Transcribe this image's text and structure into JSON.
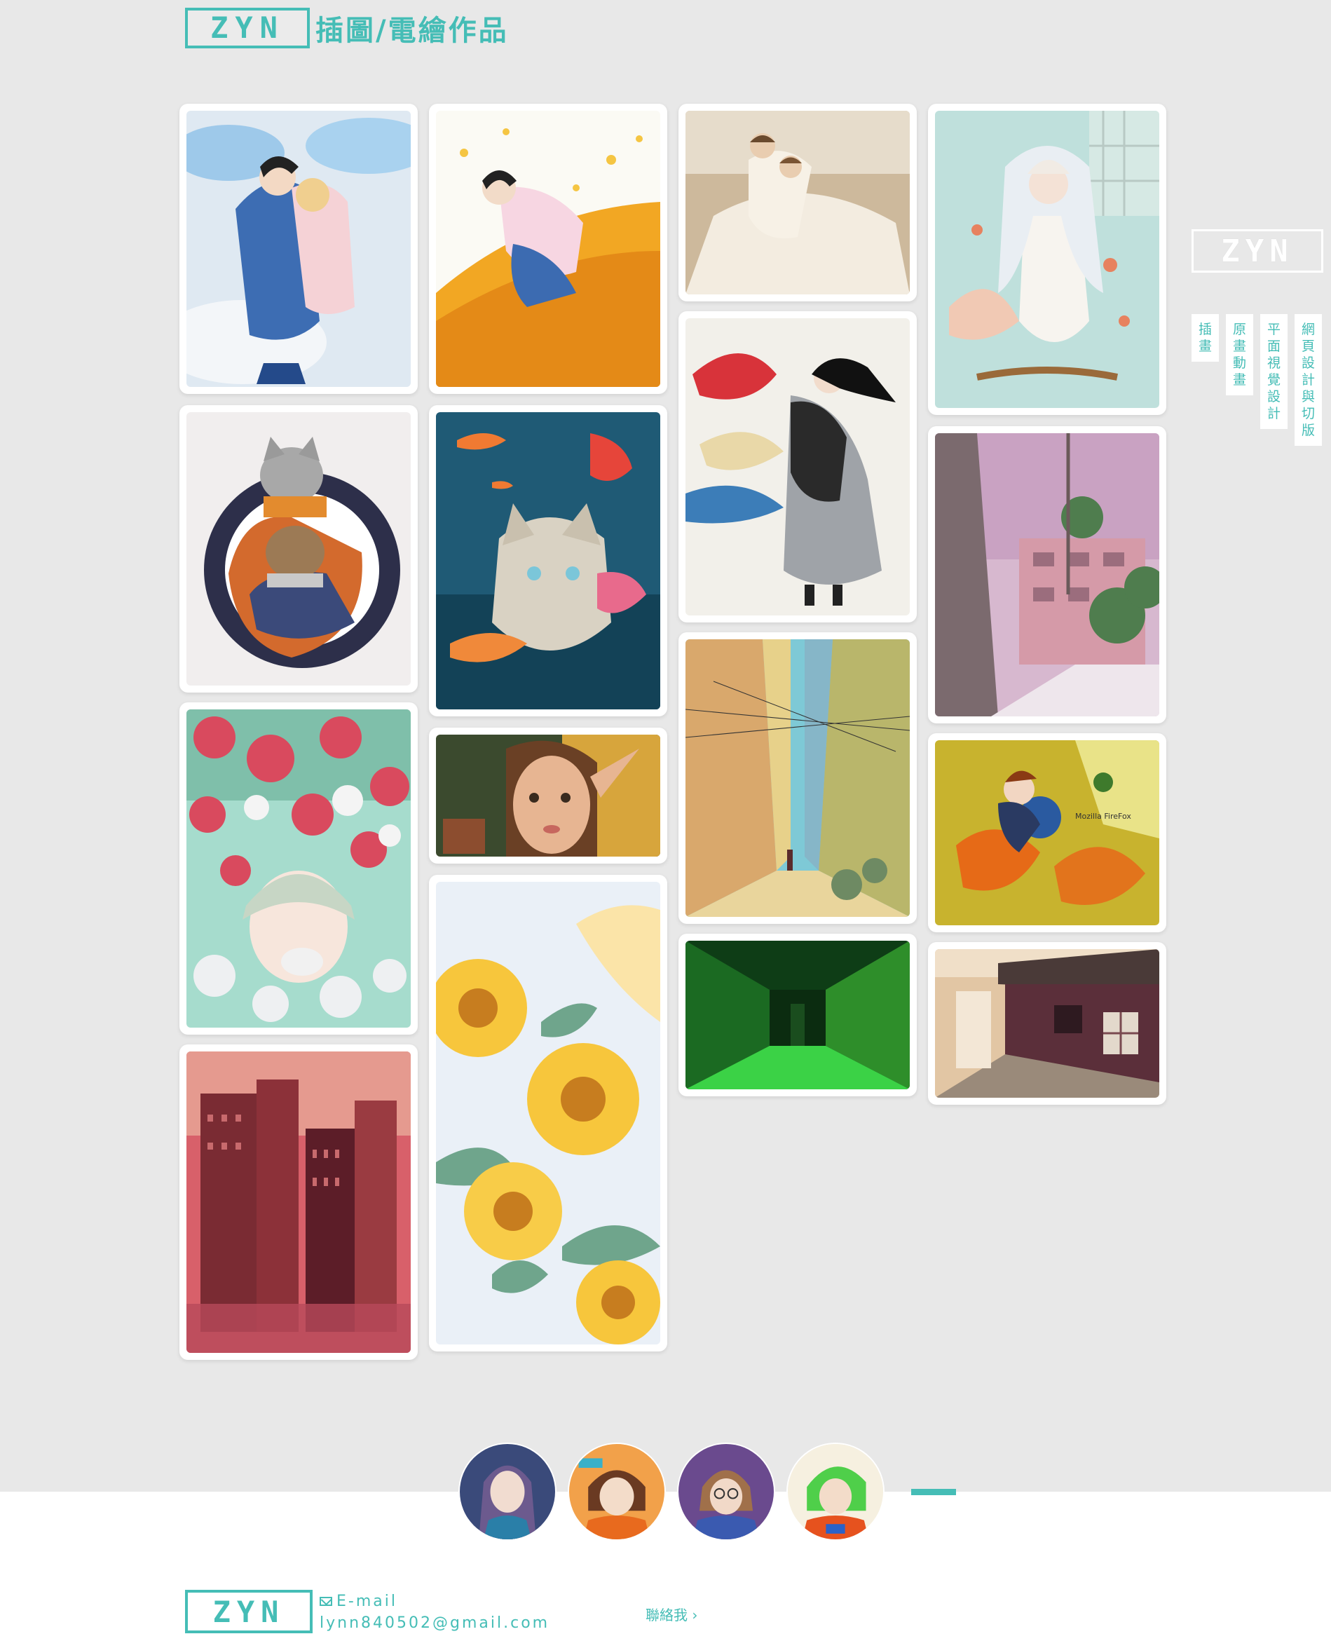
{
  "header": {
    "logo_text": "ZYN",
    "title": "插圖/電繪作品"
  },
  "side_nav": {
    "logo_text": "ZYN",
    "items": [
      {
        "label": [
          "插",
          "畫"
        ]
      },
      {
        "label": [
          "原",
          "畫",
          "動",
          "畫"
        ]
      },
      {
        "label": [
          "平",
          "面",
          "視",
          "覺",
          "設",
          "計"
        ]
      },
      {
        "label": [
          "網",
          "頁",
          "設",
          "計",
          "與",
          "切",
          "版"
        ]
      }
    ]
  },
  "gallery": {
    "artworks": [
      {
        "name": "artwork-girls-hug-clouds",
        "subject": "two girls hugging on clouds"
      },
      {
        "name": "artwork-cats-scarf",
        "subject": "two cats in scarf"
      },
      {
        "name": "artwork-lychee-girl",
        "subject": "girl with lychees"
      },
      {
        "name": "artwork-red-city",
        "subject": "red city skyline"
      },
      {
        "name": "artwork-girl-ginkgo",
        "subject": "girl on ginkgo leaves"
      },
      {
        "name": "artwork-cat-goldfish",
        "subject": "cat with goldfish"
      },
      {
        "name": "artwork-elf-portrait",
        "subject": "elf portrait"
      },
      {
        "name": "artwork-sunflowers",
        "subject": "sunflowers"
      },
      {
        "name": "artwork-couple-dress",
        "subject": "couple in white dress"
      },
      {
        "name": "artwork-girl-fish-kimono",
        "subject": "girl with red fish"
      },
      {
        "name": "artwork-alley-street",
        "subject": "alley street"
      },
      {
        "name": "artwork-green-corridor",
        "subject": "green corridor"
      },
      {
        "name": "artwork-mermaid-girl",
        "subject": "girl underwater"
      },
      {
        "name": "artwork-hillside-town",
        "subject": "hillside town"
      },
      {
        "name": "artwork-firefox",
        "subject": "girl with firefox"
      },
      {
        "name": "artwork-old-house",
        "subject": "old street house"
      }
    ],
    "watermark_texts": [
      "Mozilla FireFox"
    ]
  },
  "avatars": [
    {
      "name": "avatar-1"
    },
    {
      "name": "avatar-2"
    },
    {
      "name": "avatar-3"
    },
    {
      "name": "avatar-4"
    }
  ],
  "footer": {
    "logo_text": "ZYN",
    "email_label": "E-mail",
    "email": "lynn840502@gmail.com",
    "contact_link": "聯絡我 ›"
  },
  "colors": {
    "accent": "#45bdb6",
    "background": "#e8e8e8",
    "footer_bg": "#ffffff"
  }
}
